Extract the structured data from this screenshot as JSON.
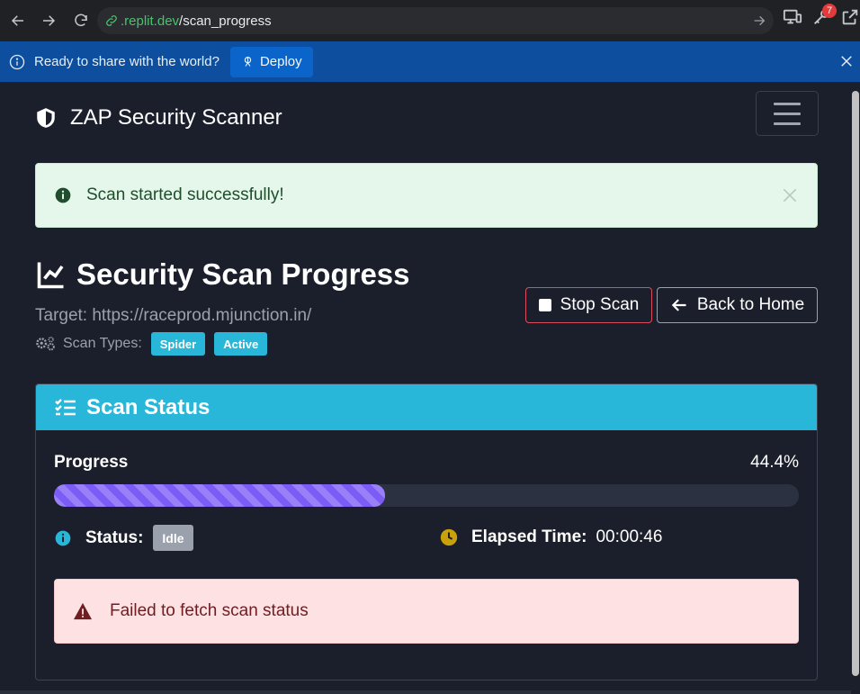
{
  "browser": {
    "url_domain": ".replit.dev",
    "url_path": "/scan_progress",
    "notification_count": "7"
  },
  "banner": {
    "text": "Ready to share with the world?",
    "deploy_label": "Deploy"
  },
  "navbar": {
    "brand": "ZAP Security Scanner"
  },
  "success_alert": {
    "message": "Scan started successfully!"
  },
  "page": {
    "title": "Security Scan Progress",
    "target": "Target: https://raceprod.mjunction.in/",
    "scan_types_label": "Scan Types:",
    "scan_types": [
      "Spider",
      "Active"
    ],
    "stop_label": "Stop Scan",
    "home_label": "Back to Home"
  },
  "card": {
    "title": "Scan Status",
    "progress_label": "Progress",
    "progress_text": "44.4%",
    "progress_value": 44.4,
    "status_label": "Status:",
    "status_value": "Idle",
    "elapsed_label": "Elapsed Time:",
    "elapsed_value": "00:00:46",
    "error_message": "Failed to fetch scan status"
  },
  "colors": {
    "accent": "#28b7d8",
    "progress": "#7c5cf7",
    "danger": "#dc4c5c",
    "success_bg": "#e4f7ea",
    "error_bg": "#fde1e3"
  }
}
